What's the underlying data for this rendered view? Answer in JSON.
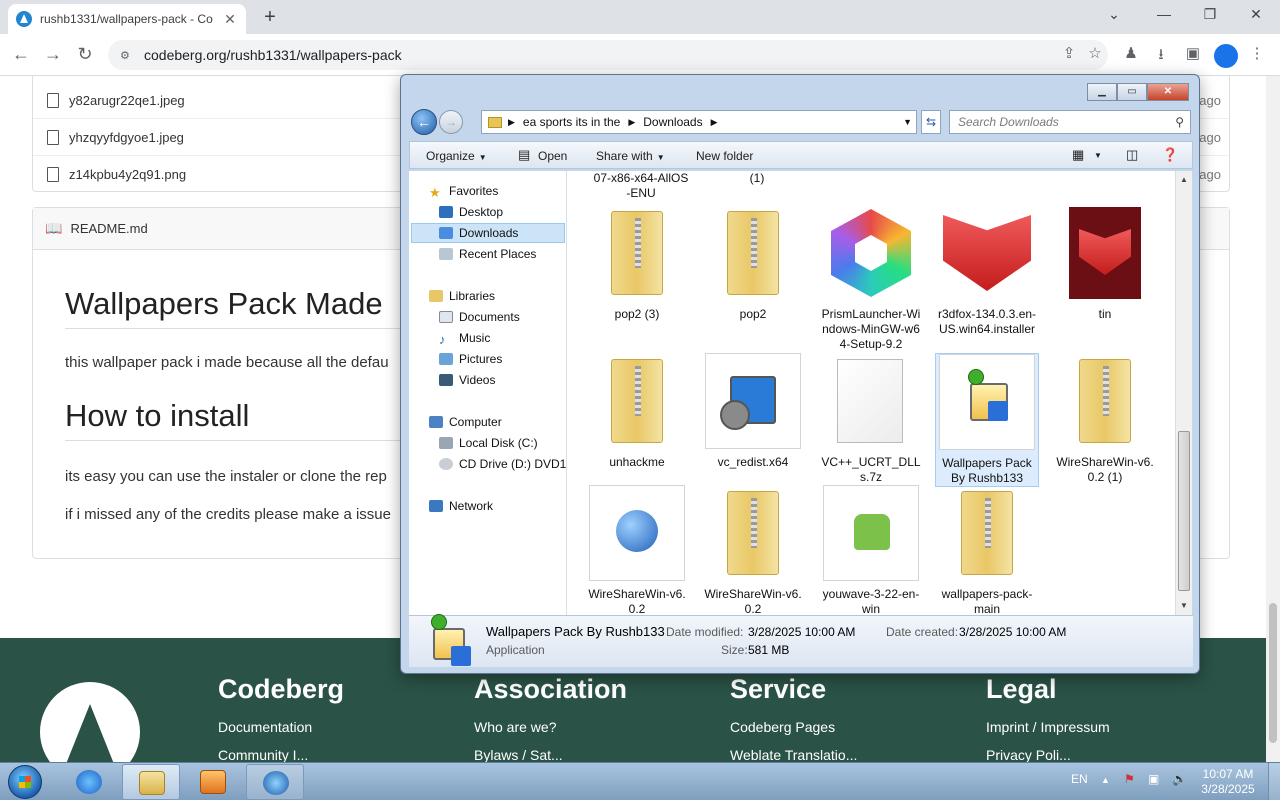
{
  "browser": {
    "tab_title": "rushb1331/wallpapers-pack - Co",
    "url": "codeberg.org/rushb1331/wallpapers-pack"
  },
  "files": [
    {
      "name": "y82arugr22qe1.jpeg",
      "age": "ago"
    },
    {
      "name": "yhzqyyfdgyoe1.jpeg",
      "age": "ago"
    },
    {
      "name": "z14kpbu4y2q91.png",
      "age": "ago"
    }
  ],
  "readme": {
    "filename": "README.md",
    "h1": "Wallpapers Pack Made",
    "p1": "this wallpaper pack i made because all the defau",
    "h2": "How to install",
    "p2": "its easy you can use the instaler or clone the rep",
    "p3": "if i missed any of the credits please make a issue"
  },
  "footer": {
    "cols": [
      {
        "title": "Codeberg",
        "items": [
          "Documentation",
          "Community I..."
        ]
      },
      {
        "title": "Association",
        "items": [
          "Who are we?",
          "Bylaws / Sat..."
        ]
      },
      {
        "title": "Service",
        "items": [
          "Codeberg Pages",
          "Weblate Translatio..."
        ]
      },
      {
        "title": "Legal",
        "items": [
          "Imprint / Impressum",
          "Privacy Poli..."
        ]
      }
    ]
  },
  "explorer": {
    "breadcrumb": [
      "ea sports its in the",
      "Downloads"
    ],
    "search_placeholder": "Search Downloads",
    "commands": {
      "organize": "Organize",
      "open": "Open",
      "share": "Share with",
      "newfolder": "New folder"
    },
    "nav": {
      "favorites": "Favorites",
      "desktop": "Desktop",
      "downloads": "Downloads",
      "recent": "Recent Places",
      "libraries": "Libraries",
      "documents": "Documents",
      "music": "Music",
      "pictures": "Pictures",
      "videos": "Videos",
      "computer": "Computer",
      "localdisk": "Local Disk (C:)",
      "cddrive": "CD Drive (D:) DVD1",
      "network": "Network"
    },
    "partial_top": [
      "07-x86-x64-AllOS\n-ENU",
      "(1)"
    ],
    "items": [
      {
        "name": "pop2 (3)",
        "icon": "zip-folder-icon"
      },
      {
        "name": "pop2",
        "icon": "zip-folder-icon"
      },
      {
        "name": "PrismLauncher-Windows-MinGW-w64-Setup-9.2",
        "icon": "prism-launcher-icon"
      },
      {
        "name": "r3dfox-134.0.3.en-US.win64.installer",
        "icon": "r3dfox-icon"
      },
      {
        "name": "tin",
        "icon": "r3dfox-file-icon"
      },
      {
        "name": "unhackme",
        "icon": "zip-folder-icon"
      },
      {
        "name": "vc_redist.x64",
        "icon": "setup-icon"
      },
      {
        "name": "VC++_UCRT_DLLs.7z",
        "icon": "blank-file-icon"
      },
      {
        "name": "Wallpapers Pack By Rushb133",
        "icon": "application-icon"
      },
      {
        "name": "WireShareWin-v6.0.2 (1)",
        "icon": "zip-folder-icon"
      },
      {
        "name": "WireShareWin-v6.0.2",
        "icon": "globe-setup-icon"
      },
      {
        "name": "WireShareWin-v6.0.2",
        "icon": "zip-folder-icon"
      },
      {
        "name": "youwave-3-22-en-win",
        "icon": "android-setup-icon"
      },
      {
        "name": "wallpapers-pack-main",
        "icon": "zip-folder-icon"
      }
    ],
    "details": {
      "name": "Wallpapers Pack By Rushb133",
      "type": "Application",
      "modified_label": "Date modified:",
      "modified": "3/28/2025 10:00 AM",
      "created_label": "Date created:",
      "created": "3/28/2025 10:00 AM",
      "size_label": "Size:",
      "size": "581 MB"
    }
  },
  "taskbar": {
    "lang": "EN",
    "time": "10:07 AM",
    "date": "3/28/2025"
  }
}
